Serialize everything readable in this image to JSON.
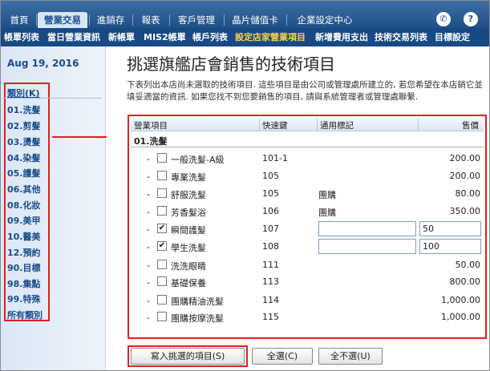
{
  "topnav": {
    "tabs": [
      "首頁",
      "營業交易",
      "進銷存",
      "報表",
      "客戶管理",
      "晶片儲值卡",
      "企業設定中心"
    ],
    "active_tab": "營業交易",
    "help_icon": "?",
    "phone_icon": "phone-icon"
  },
  "subnav": {
    "items": [
      "帳單列表",
      "當日營業資訊",
      "新帳單",
      "MIS2帳單",
      "帳戶列表",
      "設定店家營業項目",
      "新增費用支出",
      "技術交易列表",
      "目標設定"
    ],
    "active_item": "設定店家營業項目"
  },
  "sidebar": {
    "date": "Aug 19, 2016",
    "category_header": "類別(K)",
    "categories": [
      "01.洗髮",
      "02.剪髮",
      "03.燙髮",
      "04.染髮",
      "05.護髮",
      "06.其他",
      "08.化妝",
      "09.美甲",
      "10.醫美",
      "12.預約",
      "90.目標",
      "98.集點",
      "99.特殊",
      "所有類別"
    ]
  },
  "main": {
    "title": "挑選旗艦店會銷售的技術項目",
    "description": "下表列出本店尚未選取的技術項目. 這些項目是由公司或管理處所建立的, 若您希望在本店銷它並填妥適當的資訊. 如果您找不到您要銷售的項目, 請與系統管理者或管理處聯繫."
  },
  "table": {
    "headers": {
      "name": "營業項目",
      "code": "快速鍵",
      "tag": "通用標記",
      "price": "售價"
    },
    "group": "01.洗髮",
    "rows": [
      {
        "dash": "-",
        "checked": "",
        "name": "一般洗髮-A級",
        "code": "101-1",
        "tag": "",
        "price": "200.00"
      },
      {
        "dash": "-",
        "checked": "",
        "name": "專業洗髮",
        "code": "105",
        "tag": "",
        "price": "200.00"
      },
      {
        "dash": "-",
        "checked": "",
        "name": "舒服洗髮",
        "code": "105",
        "tag": "團購",
        "price": "80.00"
      },
      {
        "dash": "-",
        "checked": "",
        "name": "芳香髮浴",
        "code": "106",
        "tag": "團購",
        "price": "350.00"
      },
      {
        "dash": "-",
        "checked": "✔",
        "name": "瞬間護髮",
        "code": "107",
        "tag": "",
        "price": "50"
      },
      {
        "dash": "-",
        "checked": "✔",
        "name": "學生洗髮",
        "code": "108",
        "tag": "",
        "price": "100"
      },
      {
        "dash": "-",
        "checked": "",
        "name": "洗洗眼睛",
        "code": "111",
        "tag": "",
        "price": "50.00"
      },
      {
        "dash": "-",
        "checked": "",
        "name": "基礎保養",
        "code": "113",
        "tag": "",
        "price": "800.00"
      },
      {
        "dash": "-",
        "checked": "",
        "name": "團購精油洗髮",
        "code": "114",
        "tag": "",
        "price": "1,000.00"
      },
      {
        "dash": "-",
        "checked": "",
        "name": "團購按摩洗髮",
        "code": "115",
        "tag": "",
        "price": "1,000.00"
      }
    ]
  },
  "buttons": {
    "write": "寫入挑選的項目(S)",
    "select_all": "全選(C)",
    "select_none": "全不選(U)"
  },
  "colors": {
    "nav_blue": "#1f4f86",
    "highlight_red": "#e02020",
    "active_yellow": "#ffd24a"
  }
}
